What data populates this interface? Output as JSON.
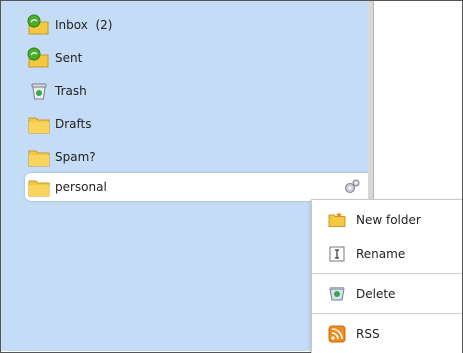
{
  "folders": [
    {
      "label": "Inbox  (2)",
      "icon": "inbox-folder-icon"
    },
    {
      "label": "Sent",
      "icon": "sent-folder-icon"
    },
    {
      "label": "Trash",
      "icon": "trash-icon"
    },
    {
      "label": "Drafts",
      "icon": "folder-icon"
    },
    {
      "label": "Spam?",
      "icon": "folder-icon"
    },
    {
      "label": "personal",
      "icon": "folder-icon",
      "selected": true
    }
  ],
  "folder_options_icon": "gear-icon",
  "context_menu": {
    "items": [
      {
        "label": "New folder",
        "icon": "new-folder-icon"
      },
      {
        "label": "Rename",
        "icon": "rename-icon"
      },
      {
        "label": "Delete",
        "icon": "delete-icon"
      },
      {
        "label": "RSS",
        "icon": "rss-icon"
      }
    ]
  },
  "colors": {
    "sidebar_bg": "#c4dcf5",
    "folder_yellow": "#f5c842",
    "inbox_green": "#4cae2a",
    "rss_orange": "#f28b1a"
  }
}
